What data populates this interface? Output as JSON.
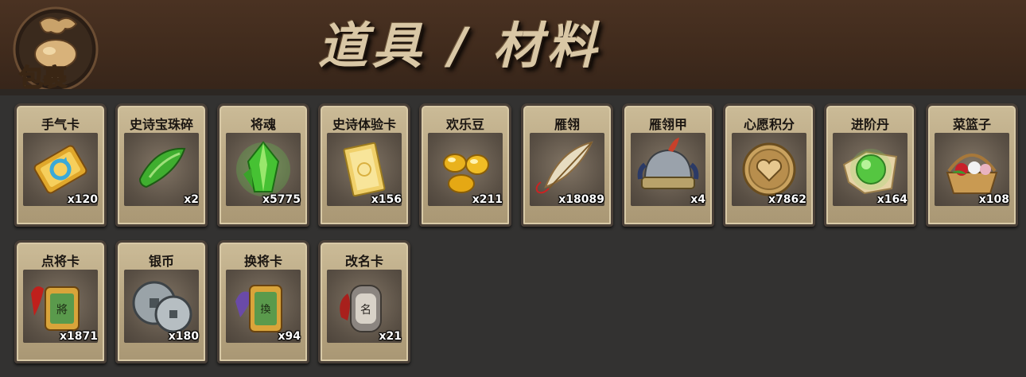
{
  "header": {
    "title": "道具 / 材料",
    "bag_label": "包裹"
  },
  "colors": {
    "header_bg": "#3f2a1c",
    "page_bg": "#333231",
    "card_bg": "#b9a783",
    "title_color": "#d9c7a5"
  },
  "items": [
    {
      "name": "手气卡",
      "count": "x120",
      "icon": "luck-card-icon"
    },
    {
      "name": "史诗宝珠碎",
      "count": "x2",
      "icon": "green-shard-icon"
    },
    {
      "name": "将魂",
      "count": "x5775",
      "icon": "green-crystal-icon"
    },
    {
      "name": "史诗体验卡",
      "count": "x156",
      "icon": "gold-card-icon"
    },
    {
      "name": "欢乐豆",
      "count": "x211",
      "icon": "gold-beans-icon"
    },
    {
      "name": "雁翎",
      "count": "x18089",
      "icon": "feather-icon"
    },
    {
      "name": "雁翎甲",
      "count": "x4",
      "icon": "helmet-icon"
    },
    {
      "name": "心愿积分",
      "count": "x7862",
      "icon": "heart-coin-icon"
    },
    {
      "name": "进阶丹",
      "count": "x164",
      "icon": "green-orb-icon"
    },
    {
      "name": "菜篮子",
      "count": "x108",
      "icon": "basket-icon"
    },
    {
      "name": "点将卡",
      "count": "x1871",
      "icon": "general-token-icon"
    },
    {
      "name": "银币",
      "count": "x180",
      "icon": "silver-coin-icon"
    },
    {
      "name": "换将卡",
      "count": "x94",
      "icon": "swap-token-icon"
    },
    {
      "name": "改名卡",
      "count": "x21",
      "icon": "rename-token-icon"
    }
  ]
}
